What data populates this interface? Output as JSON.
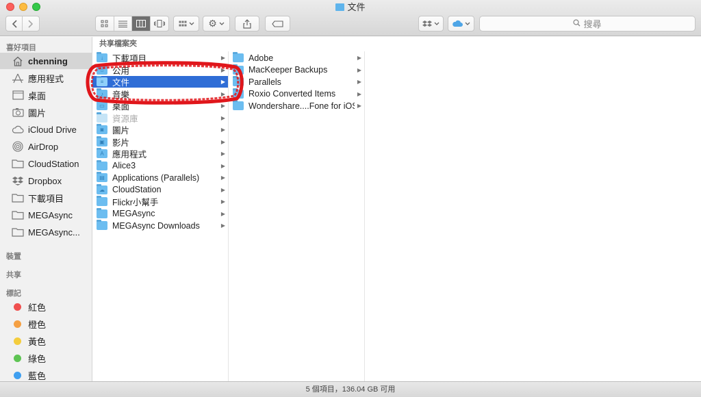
{
  "window": {
    "title": "文件"
  },
  "toolbar": {
    "search_placeholder": "搜尋"
  },
  "sidebar": {
    "favorites_header": "喜好項目",
    "favorites": [
      {
        "label": "chenning",
        "icon": "home-icon",
        "selected": true
      },
      {
        "label": "應用程式",
        "icon": "applications-icon"
      },
      {
        "label": "桌面",
        "icon": "desktop-icon"
      },
      {
        "label": "圖片",
        "icon": "camera-icon"
      },
      {
        "label": "iCloud Drive",
        "icon": "cloud-icon"
      },
      {
        "label": "AirDrop",
        "icon": "airdrop-icon"
      },
      {
        "label": "CloudStation",
        "icon": "folder-icon"
      },
      {
        "label": "Dropbox",
        "icon": "dropbox-icon"
      },
      {
        "label": "下載項目",
        "icon": "folder-icon"
      },
      {
        "label": "MEGAsync",
        "icon": "folder-icon"
      },
      {
        "label": "MEGAsync...",
        "icon": "folder-icon"
      }
    ],
    "devices_header": "裝置",
    "shared_header": "共享",
    "tags_header": "標記",
    "tags": [
      {
        "label": "紅色",
        "color": "#f0504f"
      },
      {
        "label": "橙色",
        "color": "#f5a043"
      },
      {
        "label": "黃色",
        "color": "#f4cd3d"
      },
      {
        "label": "綠色",
        "color": "#5ec453"
      },
      {
        "label": "藍色",
        "color": "#3f9ff0"
      }
    ]
  },
  "columns": {
    "header": "共享檔案夾",
    "col1": [
      {
        "label": "下載項目",
        "glyph": "↓"
      },
      {
        "label": "公用",
        "glyph": "⌂"
      },
      {
        "label": "文件",
        "glyph": "≡",
        "selected": true
      },
      {
        "label": "音樂",
        "glyph": "♪"
      },
      {
        "label": "桌面",
        "glyph": "▭"
      },
      {
        "label": "資源庫",
        "glyph": "",
        "dim": true
      },
      {
        "label": "圖片",
        "glyph": "◙"
      },
      {
        "label": "影片",
        "glyph": "▣"
      },
      {
        "label": "應用程式",
        "glyph": "A"
      },
      {
        "label": "Alice3",
        "glyph": ""
      },
      {
        "label": "Applications (Parallels)",
        "glyph": "▤"
      },
      {
        "label": "CloudStation",
        "glyph": "☁"
      },
      {
        "label": "Flickr小幫手",
        "glyph": ""
      },
      {
        "label": "MEGAsync",
        "glyph": ""
      },
      {
        "label": "MEGAsync Downloads",
        "glyph": ""
      }
    ],
    "col2": [
      {
        "label": "Adobe"
      },
      {
        "label": "MacKeeper Backups"
      },
      {
        "label": "Parallels"
      },
      {
        "label": "Roxio Converted Items"
      },
      {
        "label": "Wondershare....Fone for iOS"
      }
    ]
  },
  "status": {
    "text": "5 個項目，136.04 GB 可用"
  },
  "highlight_color": "#e0161b"
}
